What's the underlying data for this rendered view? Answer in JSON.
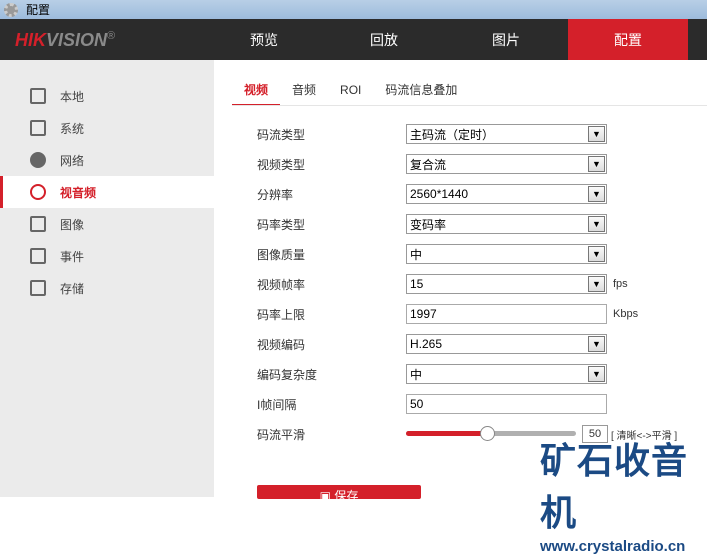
{
  "window": {
    "title": "配置"
  },
  "header": {
    "logo_red": "HIK",
    "logo_gray": "VISION",
    "logo_mark": "®",
    "nav": [
      {
        "label": "预览"
      },
      {
        "label": "回放"
      },
      {
        "label": "图片"
      },
      {
        "label": "配置",
        "active": true
      }
    ]
  },
  "sidebar": {
    "items": [
      {
        "label": "本地",
        "icon": "monitor-icon"
      },
      {
        "label": "系统",
        "icon": "window-icon"
      },
      {
        "label": "网络",
        "icon": "globe-icon"
      },
      {
        "label": "视音频",
        "icon": "mic-video-icon",
        "active": true
      },
      {
        "label": "图像",
        "icon": "image-icon"
      },
      {
        "label": "事件",
        "icon": "calendar-icon"
      },
      {
        "label": "存储",
        "icon": "floppy-icon"
      }
    ]
  },
  "tabs": [
    {
      "label": "视频",
      "active": true
    },
    {
      "label": "音频"
    },
    {
      "label": "ROI"
    },
    {
      "label": "码流信息叠加"
    }
  ],
  "form": {
    "stream_type": {
      "label": "码流类型",
      "value": "主码流（定时）"
    },
    "video_type": {
      "label": "视频类型",
      "value": "复合流"
    },
    "resolution": {
      "label": "分辨率",
      "value": "2560*1440"
    },
    "bitrate_type": {
      "label": "码率类型",
      "value": "变码率"
    },
    "image_quality": {
      "label": "图像质量",
      "value": "中"
    },
    "frame_rate": {
      "label": "视频帧率",
      "value": "15",
      "unit": "fps"
    },
    "max_bitrate": {
      "label": "码率上限",
      "value": "1997",
      "unit": "Kbps"
    },
    "video_encoding": {
      "label": "视频编码",
      "value": "H.265"
    },
    "encoding_complexity": {
      "label": "编码复杂度",
      "value": "中"
    },
    "i_frame_interval": {
      "label": "I帧间隔",
      "value": "50"
    },
    "smoothing": {
      "label": "码流平滑",
      "value": "50",
      "percent": 50,
      "hint": "[ 清晰<->平滑 ]"
    }
  },
  "save_label": "保存",
  "watermark": {
    "title": "矿石收音机",
    "url": "www.crystalradio.cn"
  }
}
